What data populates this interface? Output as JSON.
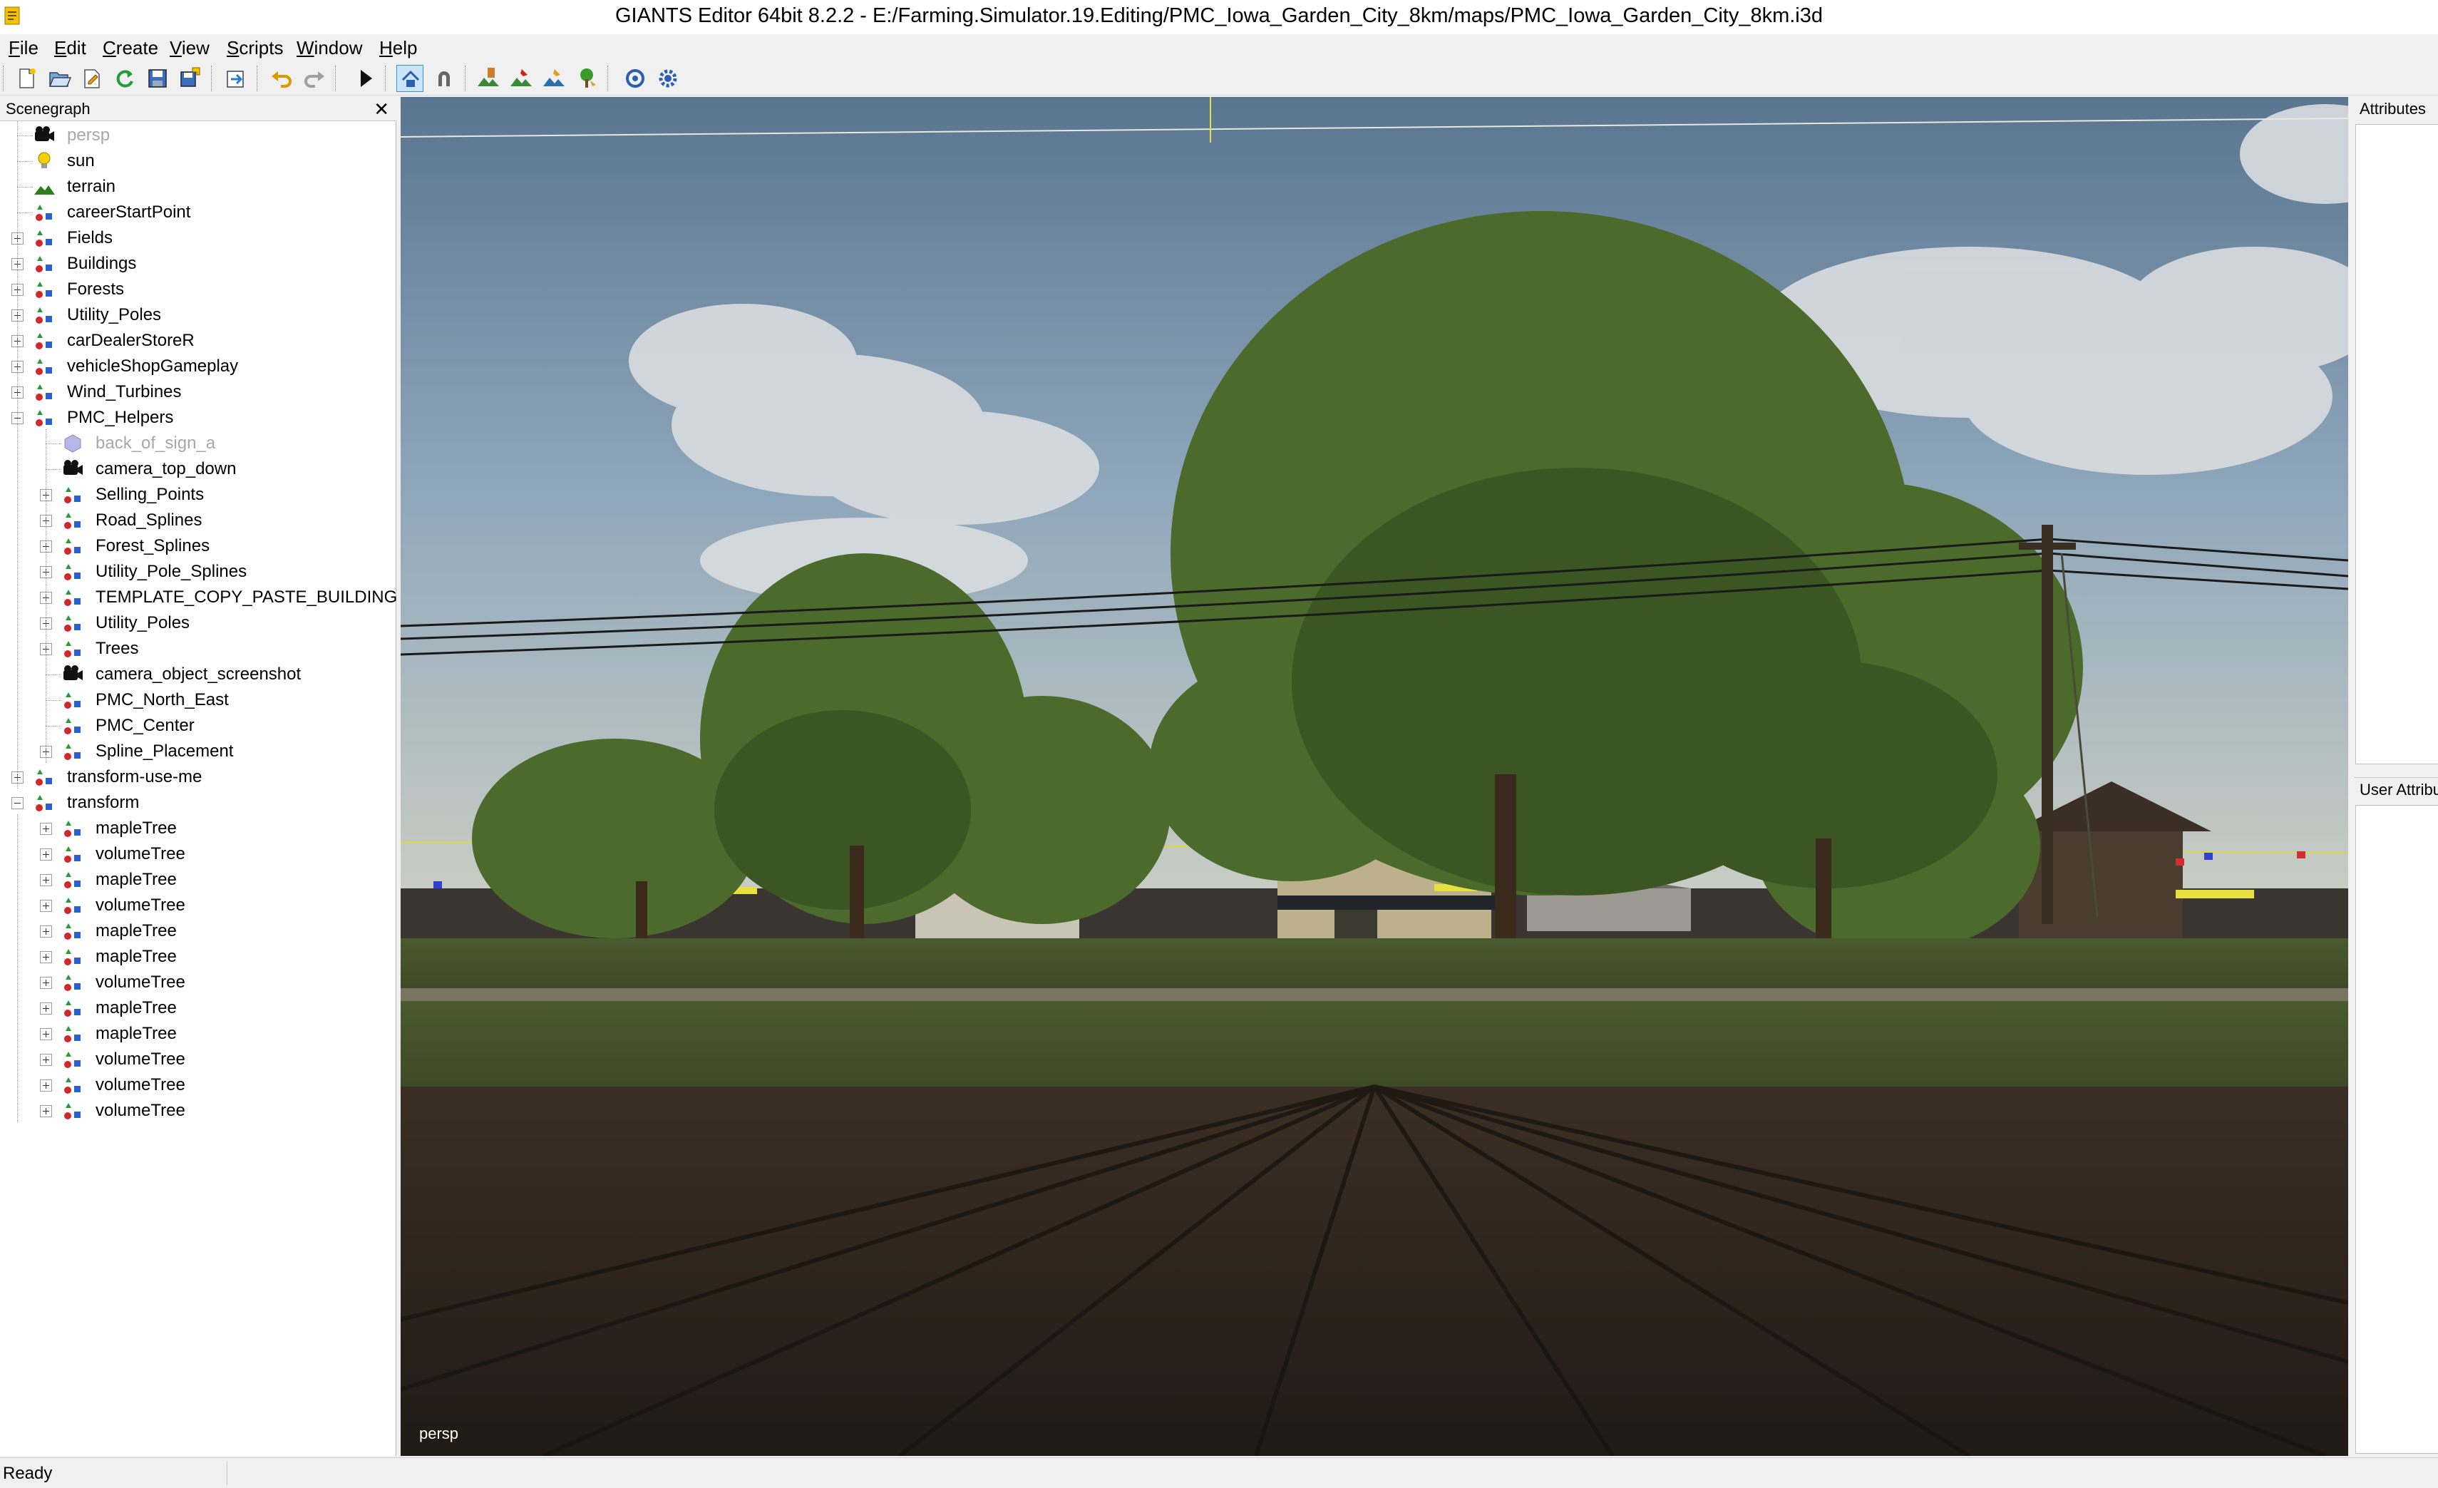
{
  "window": {
    "title": "GIANTS Editor 64bit 8.2.2 - E:/Farming.Simulator.19.Editing/PMC_Iowa_Garden_City_8km/maps/PMC_Iowa_Garden_City_8km.i3d"
  },
  "menu": [
    {
      "label": "File",
      "key": "file"
    },
    {
      "label": "Edit",
      "key": "edit"
    },
    {
      "label": "Create",
      "key": "create"
    },
    {
      "label": "View",
      "key": "view"
    },
    {
      "label": "Scripts",
      "key": "scripts"
    },
    {
      "label": "Window",
      "key": "window"
    },
    {
      "label": "Help",
      "key": "help"
    }
  ],
  "toolbar": {
    "buttons": [
      "new-file",
      "open-file",
      "import",
      "reload",
      "save",
      "save-as",
      "export",
      "undo",
      "redo",
      "play",
      "select-mode",
      "magnet",
      "terrain-sculpt",
      "terrain-paint",
      "foliage-paint",
      "tree-paint",
      "refresh",
      "settings"
    ],
    "active": "select-mode"
  },
  "scenegraph": {
    "title": "Scenegraph",
    "close": "✕",
    "nodes": [
      {
        "label": "persp",
        "icon": "camera-icon",
        "dim": true
      },
      {
        "label": "sun",
        "icon": "light-icon"
      },
      {
        "label": "terrain",
        "icon": "terrain-icon"
      },
      {
        "label": "careerStartPoint",
        "icon": "transform-group-icon"
      },
      {
        "label": "Fields",
        "icon": "transform-group-icon"
      },
      {
        "label": "Buildings",
        "icon": "transform-group-icon"
      },
      {
        "label": "Forests",
        "icon": "transform-group-icon"
      },
      {
        "label": "Utility_Poles",
        "icon": "transform-group-icon"
      },
      {
        "label": "carDealerStoreR",
        "icon": "transform-group-icon"
      },
      {
        "label": "vehicleShopGameplay",
        "icon": "transform-group-icon"
      },
      {
        "label": "Wind_Turbines",
        "icon": "transform-group-icon"
      },
      {
        "label": "PMC_Helpers",
        "icon": "transform-group-icon"
      },
      {
        "label": "back_of_sign_a",
        "icon": "shape-icon",
        "dim": true
      },
      {
        "label": "camera_top_down",
        "icon": "camera-icon"
      },
      {
        "label": "Selling_Points",
        "icon": "transform-group-icon"
      },
      {
        "label": "Road_Splines",
        "icon": "transform-group-icon"
      },
      {
        "label": "Forest_Splines",
        "icon": "transform-group-icon"
      },
      {
        "label": "Utility_Pole_Splines",
        "icon": "transform-group-icon"
      },
      {
        "label": "TEMPLATE_COPY_PASTE_BUILDING",
        "icon": "transform-group-icon"
      },
      {
        "label": "Utility_Poles",
        "icon": "transform-group-icon"
      },
      {
        "label": "Trees",
        "icon": "transform-group-icon"
      },
      {
        "label": "camera_object_screenshot",
        "icon": "camera-icon"
      },
      {
        "label": "PMC_North_East",
        "icon": "transform-group-icon"
      },
      {
        "label": "PMC_Center",
        "icon": "transform-group-icon"
      },
      {
        "label": "Spline_Placement",
        "icon": "transform-group-icon"
      },
      {
        "label": "transform-use-me",
        "icon": "transform-group-icon"
      },
      {
        "label": "transform",
        "icon": "transform-group-icon"
      },
      {
        "label": "mapleTree",
        "icon": "transform-group-icon"
      },
      {
        "label": "volumeTree",
        "icon": "transform-group-icon"
      },
      {
        "label": "mapleTree",
        "icon": "transform-group-icon"
      },
      {
        "label": "volumeTree",
        "icon": "transform-group-icon"
      },
      {
        "label": "mapleTree",
        "icon": "transform-group-icon"
      },
      {
        "label": "mapleTree",
        "icon": "transform-group-icon"
      },
      {
        "label": "volumeTree",
        "icon": "transform-group-icon"
      },
      {
        "label": "mapleTree",
        "icon": "transform-group-icon"
      },
      {
        "label": "mapleTree",
        "icon": "transform-group-icon"
      },
      {
        "label": "volumeTree",
        "icon": "transform-group-icon"
      },
      {
        "label": "volumeTree",
        "icon": "transform-group-icon"
      },
      {
        "label": "volumeTree",
        "icon": "transform-group-icon"
      }
    ]
  },
  "viewport": {
    "camera_label": "persp"
  },
  "panels": {
    "attributes": "Attributes",
    "user_attributes": "User Attributes"
  },
  "status": {
    "text": "Ready"
  }
}
